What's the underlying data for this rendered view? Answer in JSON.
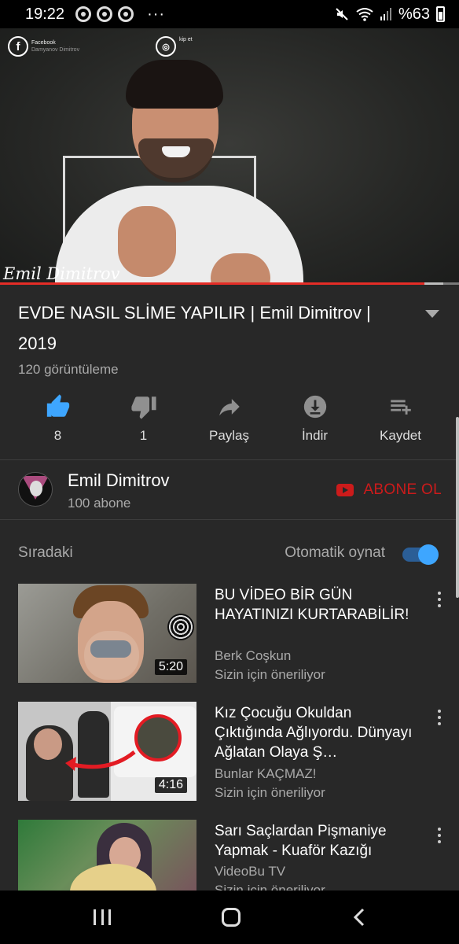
{
  "status_bar": {
    "time": "19:22",
    "dots": "···",
    "battery": "%63",
    "icons": [
      "chrome-icon",
      "chrome-icon",
      "chrome-icon",
      "mute-icon",
      "wifi-icon",
      "signal-icon",
      "battery-icon"
    ]
  },
  "player": {
    "overlay_fb_title": "Facebook",
    "overlay_fb_sub": "Damyanov Dimitrov",
    "overlay_ig_text": "kip et",
    "signature": "Emil Dimitrov",
    "progress_played_fraction": 0.925,
    "progress_buffered_fraction": 0.965
  },
  "video": {
    "title": "EVDE NASIL SLİME YAPILIR | Emil Dimitrov | 2019",
    "views": "120 görüntüleme"
  },
  "actions": [
    {
      "name": "like",
      "label": "8",
      "icon": "thumb-up-icon",
      "color": "#3ea6ff"
    },
    {
      "name": "dislike",
      "label": "1",
      "icon": "thumb-down-icon",
      "color": "#909090"
    },
    {
      "name": "share",
      "label": "Paylaş",
      "icon": "share-icon",
      "color": "#909090"
    },
    {
      "name": "download",
      "label": "İndir",
      "icon": "download-icon",
      "color": "#909090"
    },
    {
      "name": "save",
      "label": "Kaydet",
      "icon": "playlist-add-icon",
      "color": "#909090"
    }
  ],
  "channel": {
    "name": "Emil Dimitrov",
    "subscribers": "100 abone",
    "subscribe_label": "ABONE OL",
    "subscribe_color": "#cc1b1b"
  },
  "up_next": {
    "label": "Sıradaki",
    "autoplay_label": "Otomatik oynat",
    "autoplay_on": true
  },
  "recommendations": [
    {
      "title": "BU VİDEO BİR GÜN HAYATINIZI KURTARABİLİR!",
      "channel": "Berk Coşkun",
      "sub": "Sizin için öneriliyor",
      "duration": "5:20"
    },
    {
      "title": "Kız Çocuğu Okuldan Çıktığında Ağlıyordu. Dünyayı Ağlatan Olaya Ş…",
      "channel": "Bunlar KAÇMAZ!",
      "sub": "Sizin için öneriliyor",
      "duration": "4:16"
    },
    {
      "title": "Sarı Saçlardan Pişmaniye Yapmak - Kuaför Kazığı",
      "channel": "VideoBu TV",
      "sub": "Sizin için öneriliyor",
      "duration": ""
    }
  ],
  "colors": {
    "background": "#282828",
    "accent_blue": "#3ea6ff",
    "progress_red": "#e52d27"
  }
}
